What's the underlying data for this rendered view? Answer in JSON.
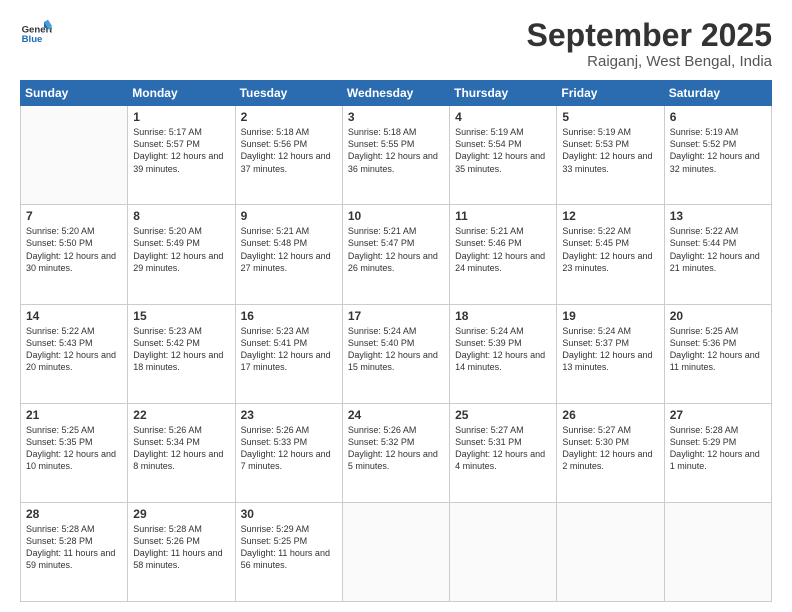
{
  "header": {
    "logo_general": "General",
    "logo_blue": "Blue",
    "month_title": "September 2025",
    "location": "Raiganj, West Bengal, India"
  },
  "weekdays": [
    "Sunday",
    "Monday",
    "Tuesday",
    "Wednesday",
    "Thursday",
    "Friday",
    "Saturday"
  ],
  "weeks": [
    [
      {
        "day": "",
        "empty": true
      },
      {
        "day": "1",
        "sunrise": "5:17 AM",
        "sunset": "5:57 PM",
        "daylight": "12 hours and 39 minutes."
      },
      {
        "day": "2",
        "sunrise": "5:18 AM",
        "sunset": "5:56 PM",
        "daylight": "12 hours and 37 minutes."
      },
      {
        "day": "3",
        "sunrise": "5:18 AM",
        "sunset": "5:55 PM",
        "daylight": "12 hours and 36 minutes."
      },
      {
        "day": "4",
        "sunrise": "5:19 AM",
        "sunset": "5:54 PM",
        "daylight": "12 hours and 35 minutes."
      },
      {
        "day": "5",
        "sunrise": "5:19 AM",
        "sunset": "5:53 PM",
        "daylight": "12 hours and 33 minutes."
      },
      {
        "day": "6",
        "sunrise": "5:19 AM",
        "sunset": "5:52 PM",
        "daylight": "12 hours and 32 minutes."
      }
    ],
    [
      {
        "day": "7",
        "sunrise": "5:20 AM",
        "sunset": "5:50 PM",
        "daylight": "12 hours and 30 minutes."
      },
      {
        "day": "8",
        "sunrise": "5:20 AM",
        "sunset": "5:49 PM",
        "daylight": "12 hours and 29 minutes."
      },
      {
        "day": "9",
        "sunrise": "5:21 AM",
        "sunset": "5:48 PM",
        "daylight": "12 hours and 27 minutes."
      },
      {
        "day": "10",
        "sunrise": "5:21 AM",
        "sunset": "5:47 PM",
        "daylight": "12 hours and 26 minutes."
      },
      {
        "day": "11",
        "sunrise": "5:21 AM",
        "sunset": "5:46 PM",
        "daylight": "12 hours and 24 minutes."
      },
      {
        "day": "12",
        "sunrise": "5:22 AM",
        "sunset": "5:45 PM",
        "daylight": "12 hours and 23 minutes."
      },
      {
        "day": "13",
        "sunrise": "5:22 AM",
        "sunset": "5:44 PM",
        "daylight": "12 hours and 21 minutes."
      }
    ],
    [
      {
        "day": "14",
        "sunrise": "5:22 AM",
        "sunset": "5:43 PM",
        "daylight": "12 hours and 20 minutes."
      },
      {
        "day": "15",
        "sunrise": "5:23 AM",
        "sunset": "5:42 PM",
        "daylight": "12 hours and 18 minutes."
      },
      {
        "day": "16",
        "sunrise": "5:23 AM",
        "sunset": "5:41 PM",
        "daylight": "12 hours and 17 minutes."
      },
      {
        "day": "17",
        "sunrise": "5:24 AM",
        "sunset": "5:40 PM",
        "daylight": "12 hours and 15 minutes."
      },
      {
        "day": "18",
        "sunrise": "5:24 AM",
        "sunset": "5:39 PM",
        "daylight": "12 hours and 14 minutes."
      },
      {
        "day": "19",
        "sunrise": "5:24 AM",
        "sunset": "5:37 PM",
        "daylight": "12 hours and 13 minutes."
      },
      {
        "day": "20",
        "sunrise": "5:25 AM",
        "sunset": "5:36 PM",
        "daylight": "12 hours and 11 minutes."
      }
    ],
    [
      {
        "day": "21",
        "sunrise": "5:25 AM",
        "sunset": "5:35 PM",
        "daylight": "12 hours and 10 minutes."
      },
      {
        "day": "22",
        "sunrise": "5:26 AM",
        "sunset": "5:34 PM",
        "daylight": "12 hours and 8 minutes."
      },
      {
        "day": "23",
        "sunrise": "5:26 AM",
        "sunset": "5:33 PM",
        "daylight": "12 hours and 7 minutes."
      },
      {
        "day": "24",
        "sunrise": "5:26 AM",
        "sunset": "5:32 PM",
        "daylight": "12 hours and 5 minutes."
      },
      {
        "day": "25",
        "sunrise": "5:27 AM",
        "sunset": "5:31 PM",
        "daylight": "12 hours and 4 minutes."
      },
      {
        "day": "26",
        "sunrise": "5:27 AM",
        "sunset": "5:30 PM",
        "daylight": "12 hours and 2 minutes."
      },
      {
        "day": "27",
        "sunrise": "5:28 AM",
        "sunset": "5:29 PM",
        "daylight": "12 hours and 1 minute."
      }
    ],
    [
      {
        "day": "28",
        "sunrise": "5:28 AM",
        "sunset": "5:28 PM",
        "daylight": "11 hours and 59 minutes."
      },
      {
        "day": "29",
        "sunrise": "5:28 AM",
        "sunset": "5:26 PM",
        "daylight": "11 hours and 58 minutes."
      },
      {
        "day": "30",
        "sunrise": "5:29 AM",
        "sunset": "5:25 PM",
        "daylight": "11 hours and 56 minutes."
      },
      {
        "day": "",
        "empty": true
      },
      {
        "day": "",
        "empty": true
      },
      {
        "day": "",
        "empty": true
      },
      {
        "day": "",
        "empty": true
      }
    ]
  ]
}
